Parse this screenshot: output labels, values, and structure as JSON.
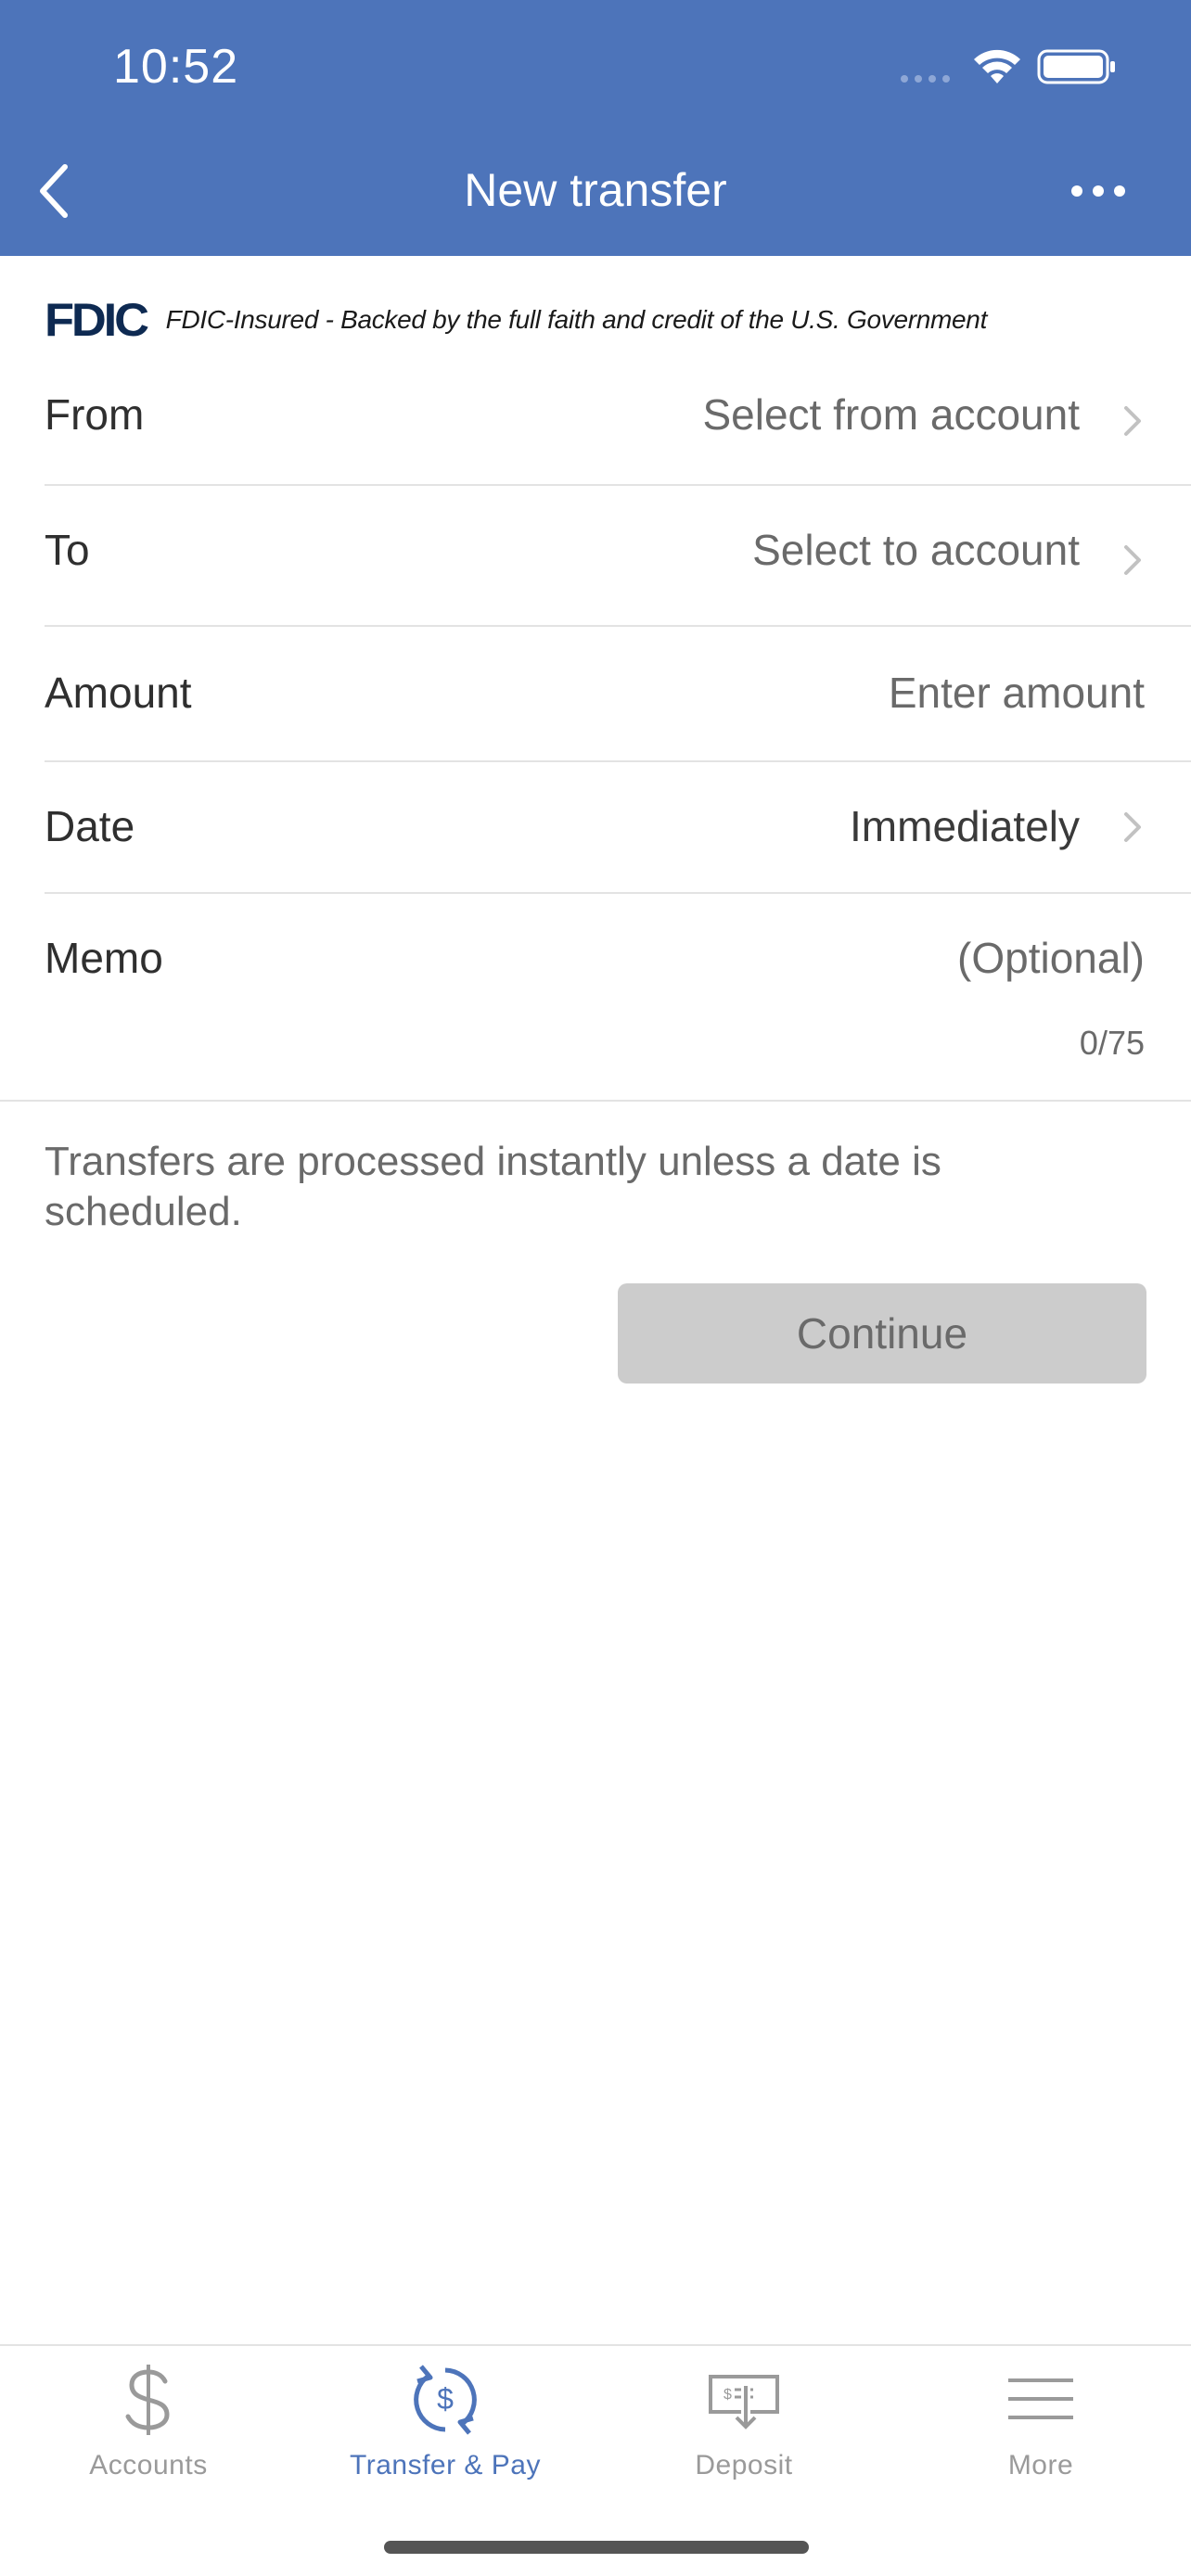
{
  "status": {
    "time": "10:52"
  },
  "header": {
    "title": "New transfer"
  },
  "fdic": {
    "logo": "FDIC",
    "text": "FDIC-Insured - Backed by the full faith and credit of the U.S. Government"
  },
  "form": {
    "from": {
      "label": "From",
      "value": "Select from account"
    },
    "to": {
      "label": "To",
      "value": "Select to account"
    },
    "amount": {
      "label": "Amount",
      "placeholder": "Enter amount"
    },
    "date": {
      "label": "Date",
      "value": "Immediately"
    },
    "memo": {
      "label": "Memo",
      "placeholder": "(Optional)",
      "count": "0/75"
    }
  },
  "info": "Transfers are processed instantly unless a date is scheduled.",
  "continue_label": "Continue",
  "tabs": [
    {
      "label": "Accounts",
      "icon": "dollar-icon"
    },
    {
      "label": "Transfer & Pay",
      "icon": "transfer-icon",
      "active": true
    },
    {
      "label": "Deposit",
      "icon": "check-deposit-icon"
    },
    {
      "label": "More",
      "icon": "menu-icon"
    }
  ],
  "colors": {
    "brand": "#4d74ba",
    "button_disabled": "#cccccc"
  }
}
